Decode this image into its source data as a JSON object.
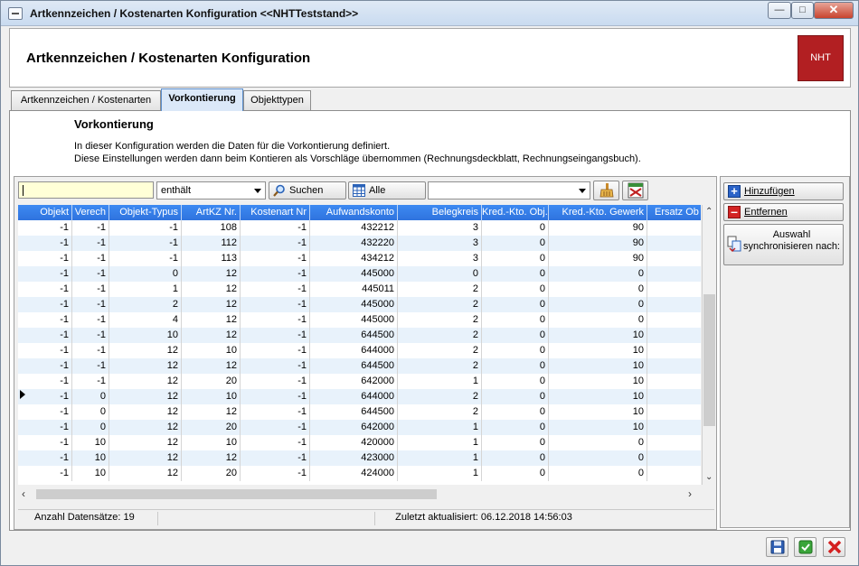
{
  "window": {
    "title": "Artkennzeichen / Kostenarten Konfiguration  <<NHTTeststand>>"
  },
  "header": {
    "title": "Artkennzeichen / Kostenarten Konfiguration",
    "logo_text": "NHT"
  },
  "tabs": [
    {
      "label": "Artkennzeichen / Kostenarten"
    },
    {
      "label": "Vorkontierung"
    },
    {
      "label": "Objekttypen"
    }
  ],
  "section": {
    "title": "Vorkontierung",
    "desc1": "In dieser Konfiguration werden die Daten für die Vorkontierung definiert.",
    "desc2": "Diese Einstellungen werden dann beim Kontieren als Vorschläge übernommen (Rechnungsdeckblatt, Rechnungseingangsbuch)."
  },
  "toolbar": {
    "search_value": "",
    "mode": "enthält",
    "search_label": "Suchen",
    "all_label": "Alle",
    "filter_value": ""
  },
  "table": {
    "columns": [
      "Objekt",
      "Verech",
      "Objekt-Typus",
      "ArtKZ Nr.",
      "Kostenart Nr",
      "Aufwandskonto",
      "Belegkreis",
      "Kred.-Kto. Obj.",
      "Kred.-Kto. Gewerk",
      "Ersatz Ob"
    ],
    "rows": [
      [
        "-1",
        "-1",
        "-1",
        "108",
        "-1",
        "432212",
        "3",
        "0",
        "90",
        ""
      ],
      [
        "-1",
        "-1",
        "-1",
        "112",
        "-1",
        "432220",
        "3",
        "0",
        "90",
        ""
      ],
      [
        "-1",
        "-1",
        "-1",
        "113",
        "-1",
        "434212",
        "3",
        "0",
        "90",
        ""
      ],
      [
        "-1",
        "-1",
        "0",
        "12",
        "-1",
        "445000",
        "0",
        "0",
        "0",
        ""
      ],
      [
        "-1",
        "-1",
        "1",
        "12",
        "-1",
        "445011",
        "2",
        "0",
        "0",
        ""
      ],
      [
        "-1",
        "-1",
        "2",
        "12",
        "-1",
        "445000",
        "2",
        "0",
        "0",
        ""
      ],
      [
        "-1",
        "-1",
        "4",
        "12",
        "-1",
        "445000",
        "2",
        "0",
        "0",
        ""
      ],
      [
        "-1",
        "-1",
        "10",
        "12",
        "-1",
        "644500",
        "2",
        "0",
        "10",
        ""
      ],
      [
        "-1",
        "-1",
        "12",
        "10",
        "-1",
        "644000",
        "2",
        "0",
        "10",
        ""
      ],
      [
        "-1",
        "-1",
        "12",
        "12",
        "-1",
        "644500",
        "2",
        "0",
        "10",
        ""
      ],
      [
        "-1",
        "-1",
        "12",
        "20",
        "-1",
        "642000",
        "1",
        "0",
        "10",
        ""
      ],
      [
        "-1",
        "0",
        "12",
        "10",
        "-1",
        "644000",
        "2",
        "0",
        "10",
        ""
      ],
      [
        "-1",
        "0",
        "12",
        "12",
        "-1",
        "644500",
        "2",
        "0",
        "10",
        ""
      ],
      [
        "-1",
        "0",
        "12",
        "20",
        "-1",
        "642000",
        "1",
        "0",
        "10",
        ""
      ],
      [
        "-1",
        "10",
        "12",
        "10",
        "-1",
        "420000",
        "1",
        "0",
        "0",
        ""
      ],
      [
        "-1",
        "10",
        "12",
        "12",
        "-1",
        "423000",
        "1",
        "0",
        "0",
        ""
      ],
      [
        "-1",
        "10",
        "12",
        "20",
        "-1",
        "424000",
        "1",
        "0",
        "0",
        ""
      ]
    ],
    "current_row": 11
  },
  "status": {
    "count": "Anzahl Datensätze: 19",
    "updated": "Zuletzt aktualisiert: 06.12.2018 14:56:03"
  },
  "side": {
    "add_label": "Hinzufügen",
    "remove_label": "Entfernen",
    "sync_line1": "Auswahl",
    "sync_line2": "synchronisieren nach:"
  }
}
